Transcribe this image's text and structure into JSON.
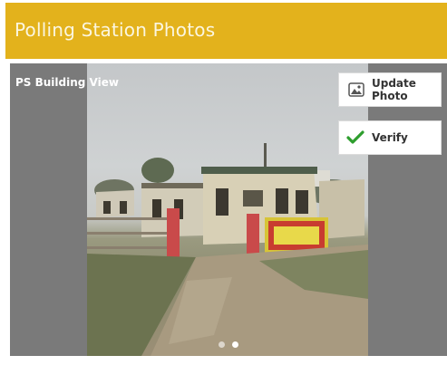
{
  "app_bar": {
    "title": "Polling Station Photos",
    "color": "#e3b21c"
  },
  "gallery": {
    "section_label": "PS Building View",
    "photo_count": 2,
    "active_index": 1
  },
  "actions": {
    "update_label": "Update Photo",
    "update_icon": "image-icon",
    "verify_label": "Verify",
    "verify_icon": "checkmark-icon",
    "verify_color": "#2e9e2e"
  }
}
